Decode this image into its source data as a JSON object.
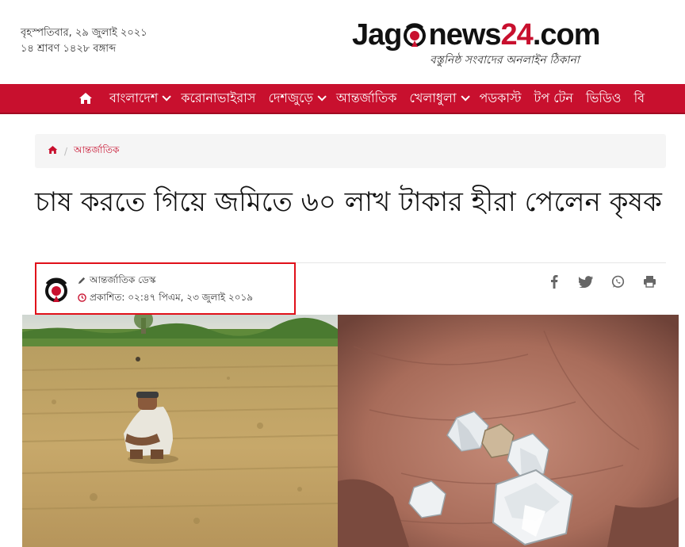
{
  "header": {
    "date_line_1": "বৃহস্পতিবার, ২৯ জুলাই ২০২১",
    "date_line_2": "১৪ শ্রাবণ ১৪২৮ বঙ্গাব্দ",
    "logo_left": "Jag",
    "logo_right_1": "news",
    "logo_right_2": "24",
    "logo_right_3": ".com",
    "tagline": "বস্তুনিষ্ঠ সংবাদের অনলাইন ঠিকানা"
  },
  "nav": {
    "items": [
      {
        "label": "বাংলাদেশ",
        "dropdown": true
      },
      {
        "label": "করোনাভাইরাস",
        "dropdown": false
      },
      {
        "label": "দেশজুড়ে",
        "dropdown": true
      },
      {
        "label": "আন্তর্জাতিক",
        "dropdown": false
      },
      {
        "label": "খেলাধুলা",
        "dropdown": true
      },
      {
        "label": "পডকাস্ট",
        "dropdown": false
      },
      {
        "label": "টপ টেন",
        "dropdown": false
      },
      {
        "label": "ভিডিও",
        "dropdown": false
      },
      {
        "label": "বি",
        "dropdown": false
      }
    ]
  },
  "breadcrumb": {
    "separator": "/",
    "current": "আন্তর্জাতিক"
  },
  "article": {
    "title": "চাষ করতে গিয়ে জমিতে ৬০ লাখ টাকার হীরা পেলেন কৃষক",
    "author": "আন্তর্জাতিক ডেস্ক",
    "published": "প্রকাশিত: ০২:৪৭ পিএম, ২৩ জুলাই ২০১৯"
  },
  "share": {
    "icons": [
      "facebook-icon",
      "twitter-icon",
      "whatsapp-icon",
      "print-icon"
    ]
  },
  "colors": {
    "brand_red": "#c8102e",
    "highlight_box": "#e0101a"
  }
}
